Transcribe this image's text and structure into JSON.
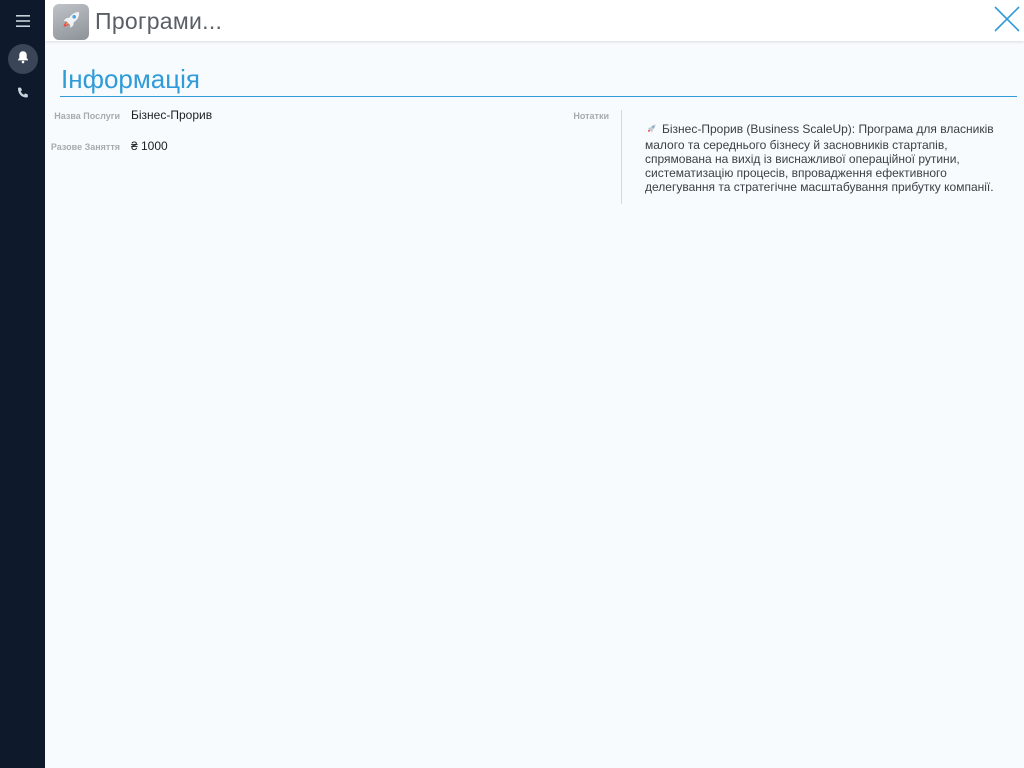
{
  "sidebar": {
    "items": [
      {
        "icon": "menu-icon"
      },
      {
        "icon": "bell-icon"
      },
      {
        "icon": "phone-icon"
      }
    ]
  },
  "header": {
    "icon": "rocket-icon",
    "title": "Програми..."
  },
  "section": {
    "title": "Інформація"
  },
  "fields": {
    "service_name_label": "Назва Послуги",
    "service_name_value": "Бізнес-Прорив",
    "single_session_label": "Разове Заняття",
    "single_session_value": "₴ 1000",
    "notes_label": "Нотатки",
    "notes_text": "Бізнес-Прорив (Business ScaleUp): Програма для власників малого та середнього бізнесу й засновників стартапів, спрямована на вихід із виснажливої операційної рутини, систематизацію процесів, впровадження ефективного делегування та стратегічне масштабування прибутку компанії."
  },
  "colors": {
    "accent": "#2f9bd8",
    "sidebar": "#0e1a2b",
    "background": "#f7fbfd"
  }
}
